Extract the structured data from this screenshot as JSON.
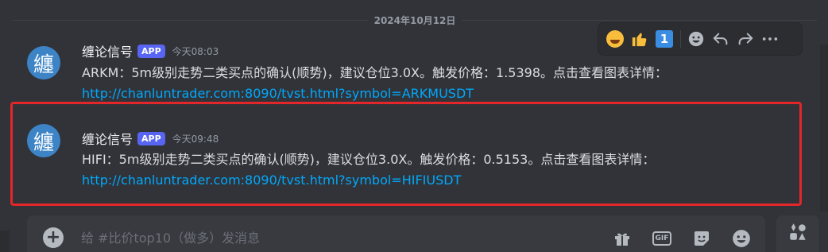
{
  "date_divider": "2024年10月12日",
  "messages": [
    {
      "avatar_glyph": "纏",
      "username": "缠论信号",
      "badge": "APP",
      "time": "今天08:03",
      "text": "ARKM：5m级别走势二类买点的确认(顺势)，建议仓位3.0X。触发价格：1.5398。点击查看图表详情：",
      "link": "http://chanluntrader.com:8090/tvst.html?symbol=ARKMUSDT"
    },
    {
      "avatar_glyph": "纏",
      "username": "缠论信号",
      "badge": "APP",
      "time": "今天09:48",
      "text": "HIFI：5m级别走势二类买点的确认(顺势)，建议仓位3.0X。触发价格：0.5153。点击查看图表详情：",
      "link": "http://chanluntrader.com:8090/tvst.html?symbol=HIFIUSDT"
    }
  ],
  "toolbar": {
    "reactions": [
      "laughing-face-icon",
      "thumbs-up-icon",
      "keycap-one-icon"
    ],
    "keycap_text": "1",
    "actions": [
      "add-reaction-icon",
      "reply-icon",
      "forward-icon",
      "more-icon"
    ]
  },
  "composer": {
    "placeholder": "给 #比价top10（做多）发消息",
    "gif_label": "GIF",
    "icons": [
      "gift-icon",
      "gif-icon",
      "sticker-icon",
      "emoji-icon",
      "apps-icon"
    ]
  },
  "colors": {
    "background": "#313338",
    "link": "#00a8fc",
    "badge": "#5865f2",
    "highlight": "#e3262a",
    "avatar": "#3d84c6"
  }
}
